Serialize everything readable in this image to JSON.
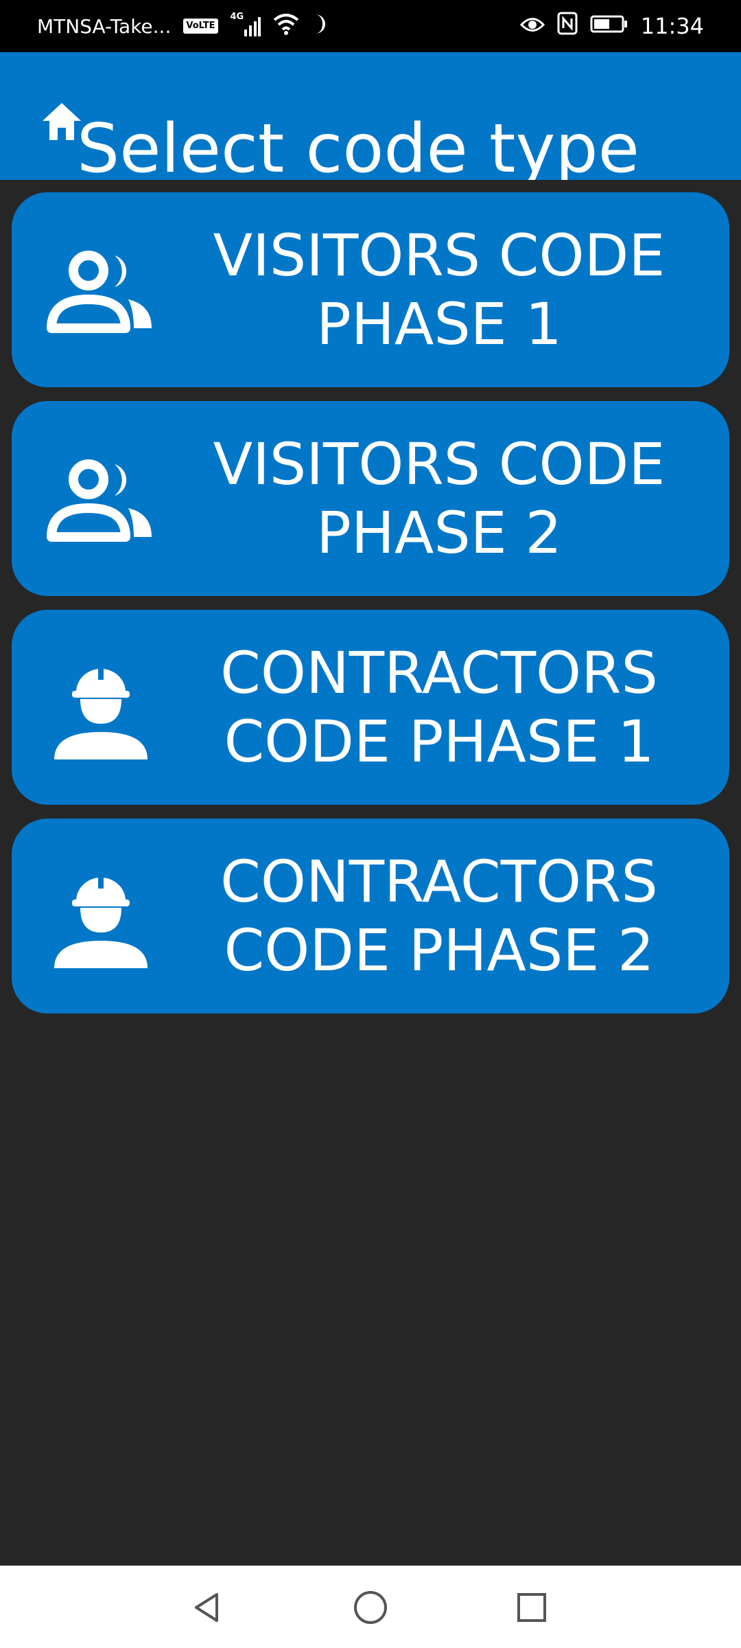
{
  "status_bar": {
    "carrier": "MTNSA-Take...",
    "volte_badge": "VoLTE",
    "network_type": "4G",
    "time": "11:34"
  },
  "header": {
    "title": "Select code type",
    "home_icon": "home-icon"
  },
  "buttons": [
    {
      "label": "VISITORS CODE\nPHASE 1",
      "icon": "visitors-icon"
    },
    {
      "label": "VISITORS CODE\nPHASE 2",
      "icon": "visitors-icon"
    },
    {
      "label": "CONTRACTORS\nCODE PHASE 1",
      "icon": "contractor-icon"
    },
    {
      "label": "CONTRACTORS\nCODE PHASE 2",
      "icon": "contractor-icon"
    }
  ],
  "nav_bar": {
    "back_icon": "back-triangle-icon",
    "home_icon": "home-circle-icon",
    "recents_icon": "recents-square-icon"
  },
  "colors": {
    "primary": "#0277c8",
    "background": "#262626",
    "status_bar": "#000000",
    "nav_bar": "#ffffff"
  }
}
